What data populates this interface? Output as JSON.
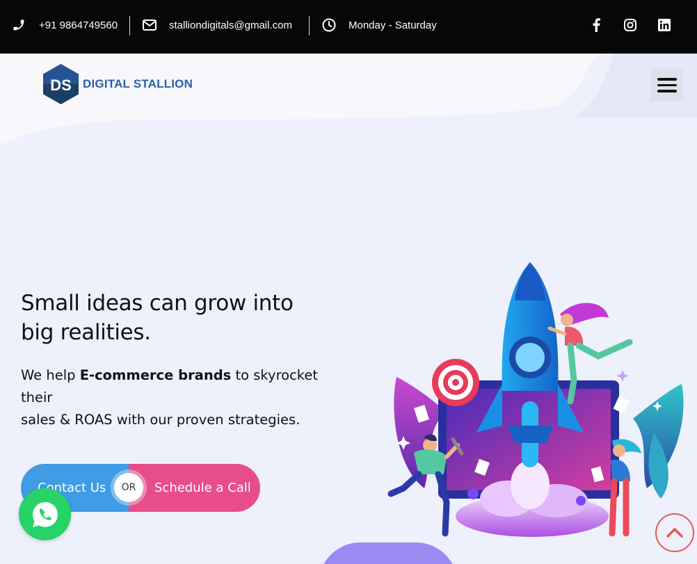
{
  "topbar": {
    "phone": "+91 9864749560",
    "email": "stalliondigitals@gmail.com",
    "hours": "Monday - Saturday",
    "social": [
      "facebook-icon",
      "instagram-icon",
      "linkedin-icon"
    ]
  },
  "header": {
    "logo_mark": "DS",
    "logo_text": "DIGITAL STALLION"
  },
  "hero": {
    "title_line1": "Small ideas can grow into",
    "title_line2": "big realities.",
    "sub_pre": "We help ",
    "sub_bold": "E-commerce brands",
    "sub_post": " to skyrocket their",
    "sub_line2": "sales & ROAS  with our proven strategies."
  },
  "cta": {
    "contact_label": "Contact Us",
    "or_label": "OR",
    "schedule_label": "Schedule a Call"
  },
  "colors": {
    "topbar_bg": "#070707",
    "page_bg": "#eef0fb",
    "contact_blue": "#3f9ce5",
    "schedule_pink": "#e74d8c",
    "whatsapp_green": "#25d366",
    "scroll_ring": "#e35a4f",
    "logo_blue": "#2a5ea8"
  }
}
